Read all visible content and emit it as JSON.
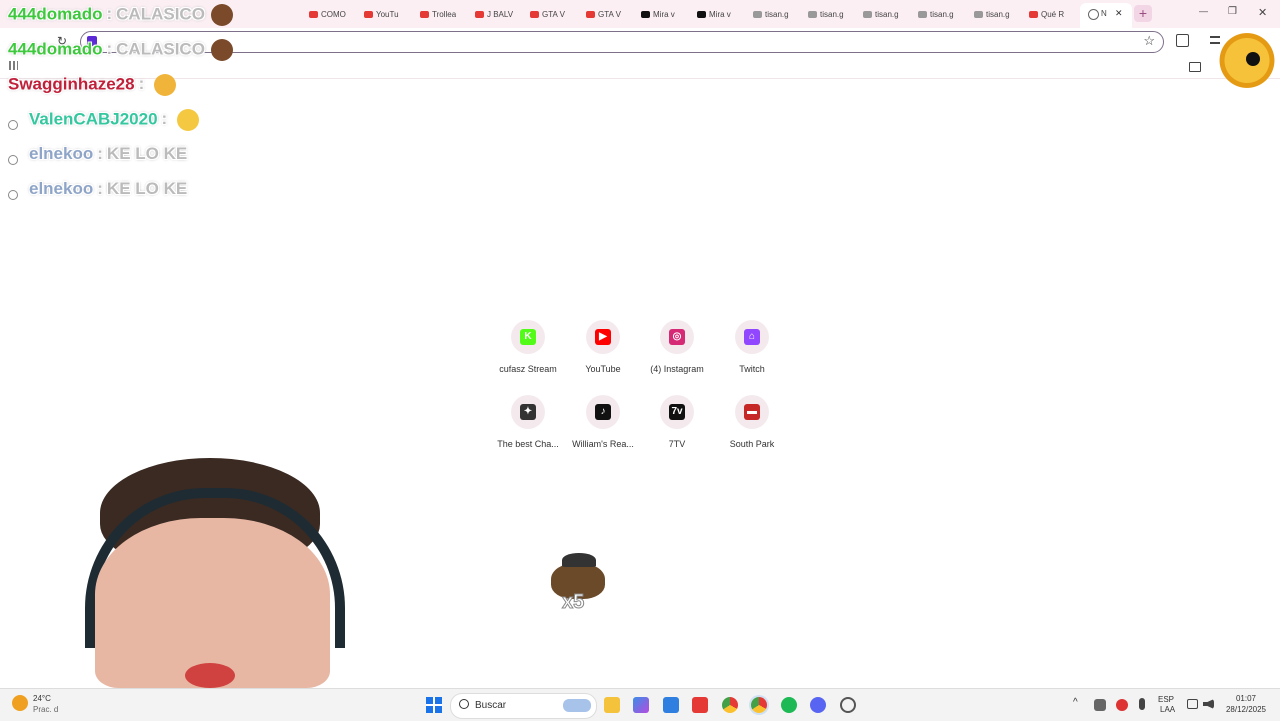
{
  "browser": {
    "tabs": [
      {
        "label": "COMO",
        "color": "#e53935"
      },
      {
        "label": "YouTu",
        "color": "#e53935"
      },
      {
        "label": "Trollea",
        "color": "#e53935"
      },
      {
        "label": "J BALV",
        "color": "#e53935"
      },
      {
        "label": "GTA V",
        "color": "#e53935"
      },
      {
        "label": "GTA V",
        "color": "#e53935"
      },
      {
        "label": "Mira v",
        "color": "#111111"
      },
      {
        "label": "Mira v",
        "color": "#111111"
      },
      {
        "label": "tisan.g",
        "color": "#999999"
      },
      {
        "label": "tisan.g",
        "color": "#999999"
      },
      {
        "label": "tisan.g",
        "color": "#999999"
      },
      {
        "label": "tisan.g",
        "color": "#999999"
      },
      {
        "label": "tisan.g",
        "color": "#999999"
      },
      {
        "label": "Qué R",
        "color": "#e53935"
      }
    ],
    "active_tab": {
      "label": "N"
    },
    "new_tab_icon": "plus-icon",
    "window_controls": {
      "minimize": "—",
      "restore": "❐",
      "close": "✕"
    },
    "close_tab": "✕"
  },
  "chat": [
    {
      "user": "444domado",
      "user_color": "#3ec83e",
      "message": "CALASICO"
    },
    {
      "user": "444domado",
      "user_color": "#3ec83e",
      "message": "CALASICO"
    },
    {
      "user": "Swagginhaze28",
      "user_color": "#c0203a",
      "message": ""
    },
    {
      "user": "ValenCABJ2020",
      "user_color": "#35c79f",
      "message": ""
    },
    {
      "user": "elnekoo",
      "user_color": "#8fa5c8",
      "message": "KE LO KE"
    },
    {
      "user": "elnekoo",
      "user_color": "#8fa5c8",
      "message": "KE LO KE"
    }
  ],
  "chat_separator": ":",
  "shortcuts": [
    {
      "label": "cufasz Stream",
      "icon": "kick-icon",
      "color": "#53fc18"
    },
    {
      "label": "YouTube",
      "icon": "youtube-icon",
      "color": "#ff0000"
    },
    {
      "label": "(4) Instagram",
      "icon": "instagram-icon",
      "color": "#d62976"
    },
    {
      "label": "Twitch",
      "icon": "twitch-icon",
      "color": "#9146ff"
    },
    {
      "label": "The best Cha...",
      "icon": "chat-icon",
      "color": "#333333"
    },
    {
      "label": "William's Rea...",
      "icon": "tiktok-icon",
      "color": "#111111"
    },
    {
      "label": "7TV",
      "icon": "seventv-icon",
      "color": "#111111"
    },
    {
      "label": "South Park",
      "icon": "southpark-icon",
      "color": "#c62828"
    }
  ],
  "overlay_counter": "x5",
  "taskbar": {
    "weather_temp": "24°C",
    "weather_desc": "Prac. d",
    "search_placeholder": "Buscar",
    "language": "ESP",
    "language_sub": "LAA",
    "time": "01:07",
    "date": "28/12/2025"
  }
}
